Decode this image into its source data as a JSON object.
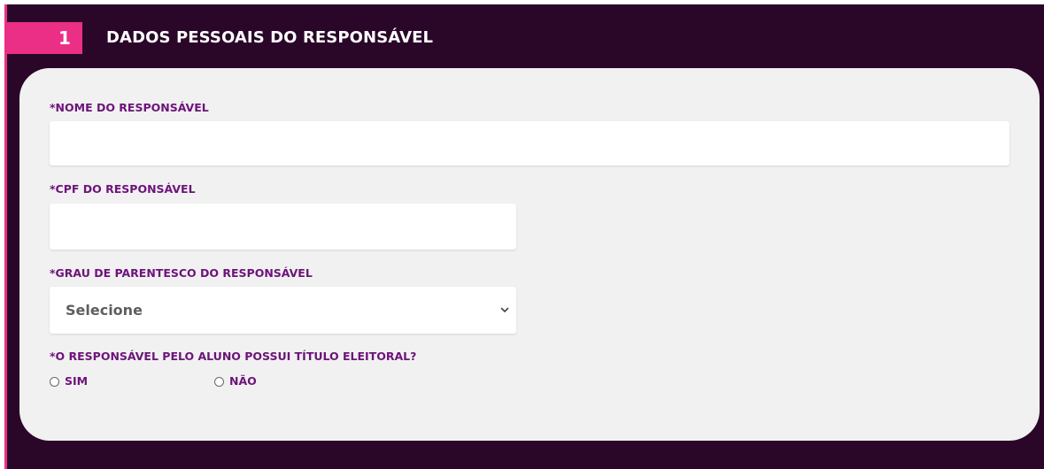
{
  "section": {
    "number": "1",
    "title": "DADOS PESSOAIS DO RESPONSÁVEL"
  },
  "fields": {
    "nome": {
      "label": "*NOME DO RESPONSÁVEL",
      "value": "",
      "placeholder": ""
    },
    "cpf": {
      "label": "*CPF DO RESPONSÁVEL",
      "value": "",
      "placeholder": ""
    },
    "parentesco": {
      "label": "*GRAU DE PARENTESCO DO RESPONSÁVEL",
      "selected": "Selecione"
    },
    "titulo_eleitoral": {
      "label": "*O RESPONSÁVEL PELO ALUNO POSSUI TÍTULO ELEITORAL?",
      "options": [
        {
          "label": "SIM",
          "checked": false
        },
        {
          "label": "NÃO",
          "checked": false
        }
      ]
    }
  },
  "colors": {
    "background": "#2a0629",
    "accent": "#ec2f86",
    "card": "#f1f1f1",
    "label": "#6d137a"
  },
  "icons": {
    "select_arrow": "chevron-down-icon",
    "radio": "radio-empty-icon"
  }
}
